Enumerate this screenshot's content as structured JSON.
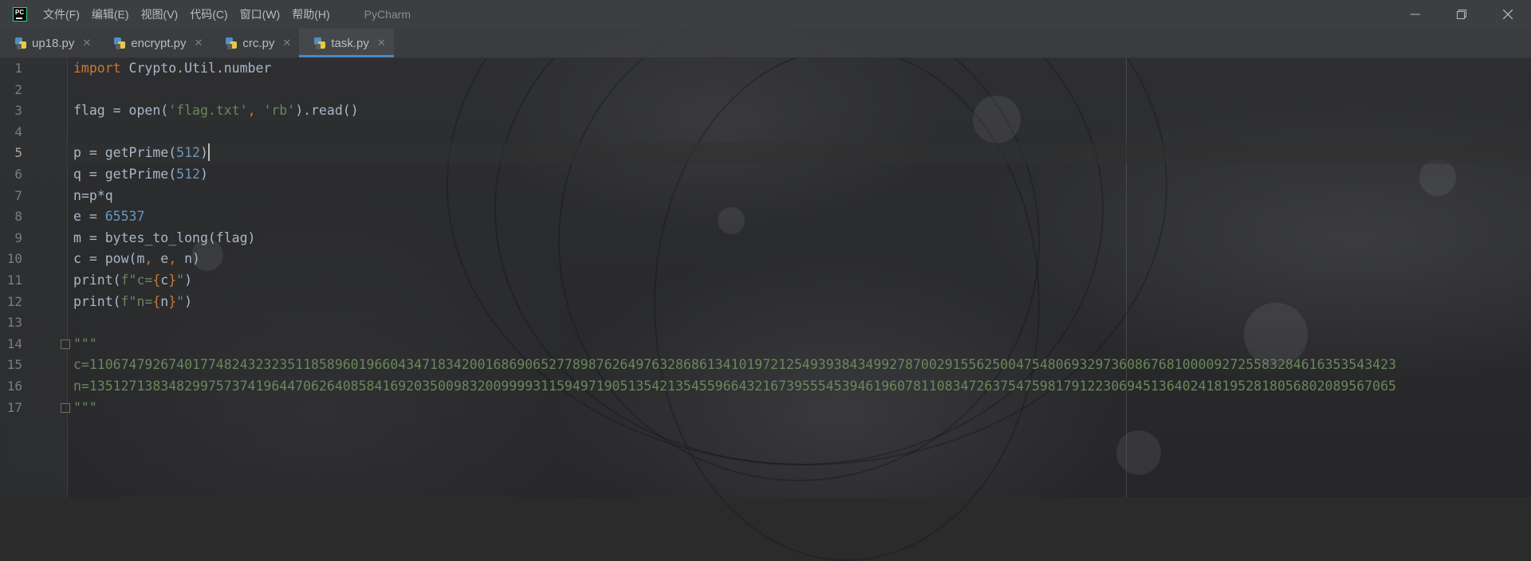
{
  "titlebar": {
    "menus": [
      "文件(F)",
      "编辑(E)",
      "视图(V)",
      "代码(C)",
      "窗口(W)",
      "帮助(H)"
    ],
    "app_title": "PyCharm",
    "logo_text": "PC"
  },
  "tabs": [
    {
      "label": "up18.py",
      "active": false
    },
    {
      "label": "encrypt.py",
      "active": false
    },
    {
      "label": "crc.py",
      "active": false
    },
    {
      "label": "task.py",
      "active": true
    }
  ],
  "editor": {
    "current_line": 5,
    "lines": [
      {
        "n": "1",
        "text": "import Crypto.Util.number"
      },
      {
        "n": "2",
        "text": ""
      },
      {
        "n": "3",
        "text": "flag = open('flag.txt', 'rb').read()"
      },
      {
        "n": "4",
        "text": ""
      },
      {
        "n": "5",
        "text": "p = getPrime(512)"
      },
      {
        "n": "6",
        "text": "q = getPrime(512)"
      },
      {
        "n": "7",
        "text": "n=p*q"
      },
      {
        "n": "8",
        "text": "e = 65537"
      },
      {
        "n": "9",
        "text": "m = bytes_to_long(flag)"
      },
      {
        "n": "10",
        "text": "c = pow(m, e, n)"
      },
      {
        "n": "11",
        "text": "print(f\"c={c}\")"
      },
      {
        "n": "12",
        "text": "print(f\"n={n}\")"
      },
      {
        "n": "13",
        "text": ""
      },
      {
        "n": "14",
        "text": "\"\"\""
      },
      {
        "n": "15",
        "text": "c=110674792674017748243232351185896019660434718342001686906527789876264976328686134101972125493938434992787002915562500475480693297360867681000092725583284616353543423"
      },
      {
        "n": "16",
        "text": "n=135127138348299757374196447062640858416920350098320099993115949719051354213545596643216739555453946196078110834726375475981791223069451364024181952818056802089567065"
      },
      {
        "n": "17",
        "text": "\"\"\""
      }
    ]
  },
  "colors": {
    "keyword": "#cc7832",
    "string": "#6a8759",
    "number": "#6897bb",
    "text": "#a9b7c6",
    "accent": "#4a88c7"
  }
}
